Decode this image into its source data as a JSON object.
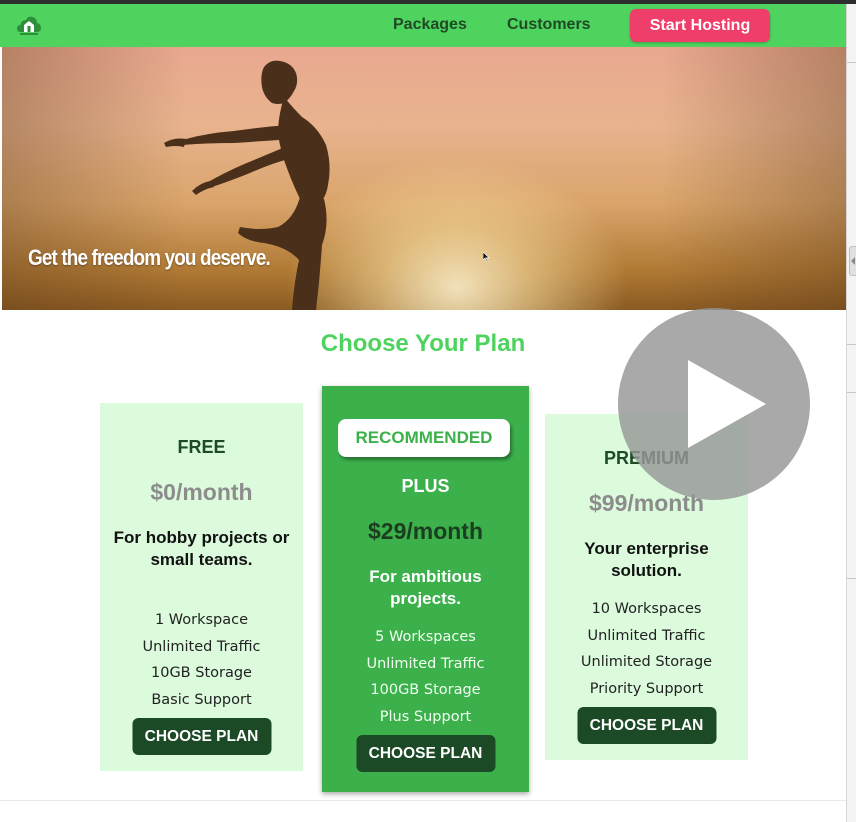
{
  "nav": {
    "logo_icon": "house-cloud-logo-icon",
    "links": [
      "Packages",
      "Customers"
    ],
    "cta_label": "Start Hosting",
    "colors": {
      "bar": "#4fd35f",
      "cta": "#f03e6b"
    }
  },
  "hero": {
    "tagline": "Get the freedom you deserve."
  },
  "pricing": {
    "title": "Choose Your Plan",
    "plans": [
      {
        "name": "FREE",
        "price": "$0/month",
        "description": "For hobby projects or small teams.",
        "features": [
          "1 Workspace",
          "Unlimited Traffic",
          "10GB Storage",
          "Basic Support"
        ],
        "button": "CHOOSE PLAN"
      },
      {
        "badge": "RECOMMENDED",
        "name": "PLUS",
        "price": "$29/month",
        "description": "For ambitious projects.",
        "features": [
          "5 Workspaces",
          "Unlimited Traffic",
          "100GB Storage",
          "Plus Support"
        ],
        "button": "CHOOSE PLAN"
      },
      {
        "name": "PREMIUM",
        "price": "$99/month",
        "description": "Your enterprise solution.",
        "features": [
          "10 Workspaces",
          "Unlimited Traffic",
          "Unlimited Storage",
          "Priority Support"
        ],
        "button": "CHOOSE PLAN"
      }
    ],
    "colors": {
      "card": "#dcfbdd",
      "highlight": "#3bb04b",
      "button": "#1c4a26"
    }
  },
  "overlay": {
    "icon": "play-icon"
  }
}
